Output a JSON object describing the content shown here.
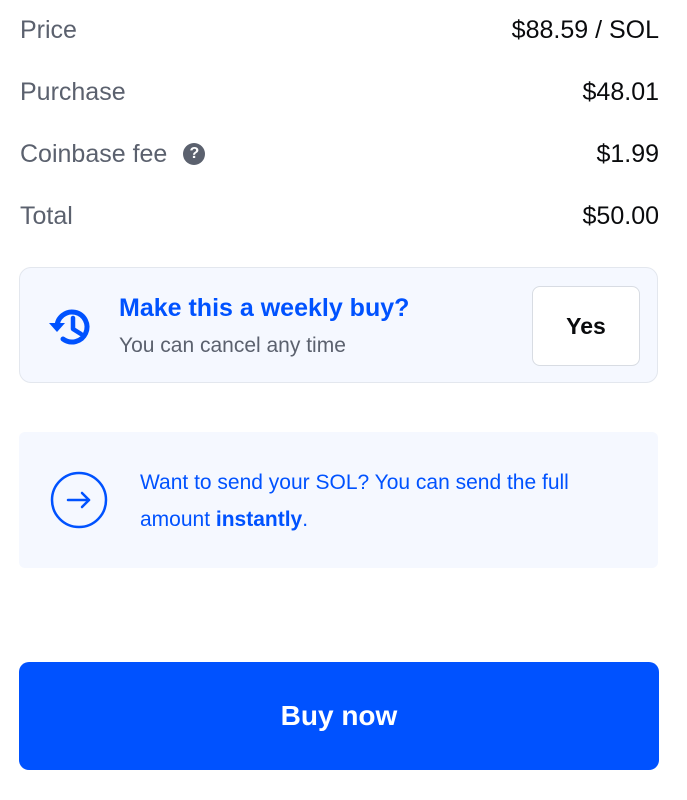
{
  "summary": {
    "price": {
      "label": "Price",
      "value": "$88.59 / SOL"
    },
    "purchase": {
      "label": "Purchase",
      "value": "$48.01"
    },
    "fee": {
      "label": "Coinbase fee",
      "value": "$1.99",
      "help_icon": "question-circle-icon",
      "help_glyph": "?"
    },
    "total": {
      "label": "Total",
      "value": "$50.00"
    }
  },
  "weekly": {
    "icon": "recurring-history-icon",
    "title": "Make this a weekly buy?",
    "subtitle": "You can cancel any time",
    "yes_label": "Yes"
  },
  "send": {
    "icon": "arrow-right-circle-icon",
    "text_before": "Want to send your SOL? You can send the full amount ",
    "text_bold": "instantly",
    "text_after": "."
  },
  "buy": {
    "label": "Buy now"
  },
  "colors": {
    "accent": "#0052ff",
    "muted": "#5b616e",
    "card_bg": "#f5f8ff"
  }
}
